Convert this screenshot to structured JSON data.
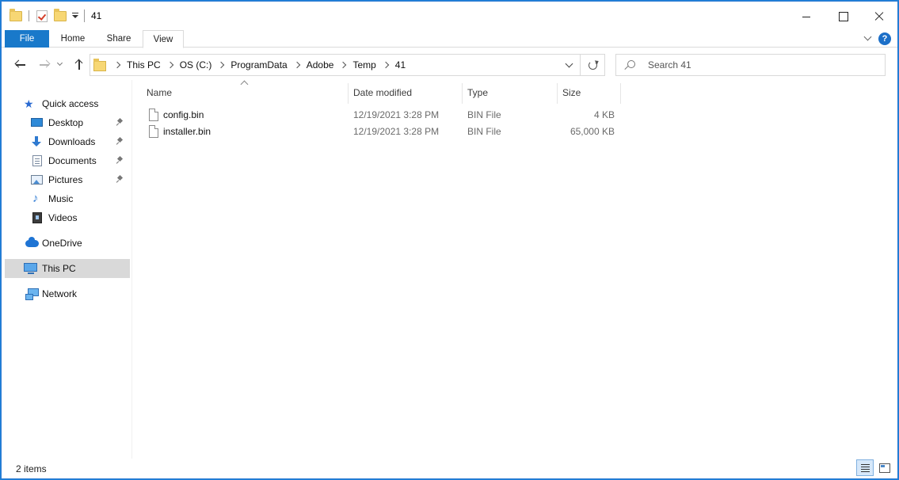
{
  "window": {
    "title": "41"
  },
  "ribbon": {
    "tabs": [
      "File",
      "Home",
      "Share",
      "View"
    ],
    "help_label": "?"
  },
  "address": {
    "breadcrumbs": [
      "This PC",
      "OS (C:)",
      "ProgramData",
      "Adobe",
      "Temp",
      "41"
    ]
  },
  "search": {
    "placeholder": "Search 41"
  },
  "nav": {
    "quick_access": "Quick access",
    "pinned": [
      "Desktop",
      "Downloads",
      "Documents",
      "Pictures"
    ],
    "libraries": [
      "Music",
      "Videos"
    ],
    "onedrive": "OneDrive",
    "this_pc": "This PC",
    "network": "Network"
  },
  "filelist": {
    "columns": [
      "Name",
      "Date modified",
      "Type",
      "Size"
    ],
    "rows": [
      {
        "name": "config.bin",
        "date": "12/19/2021 3:28 PM",
        "type": "BIN File",
        "size": "4 KB"
      },
      {
        "name": "installer.bin",
        "date": "12/19/2021 3:28 PM",
        "type": "BIN File",
        "size": "65,000 KB"
      }
    ]
  },
  "status": {
    "item_count": "2 items"
  },
  "icons": {
    "folder": "folder-icon",
    "properties": "properties-icon",
    "file": "file-icon",
    "search": "search-icon"
  },
  "colors": {
    "accent": "#1979ca",
    "selection": "#d9d9d9",
    "window_border": "#2b79d0"
  }
}
